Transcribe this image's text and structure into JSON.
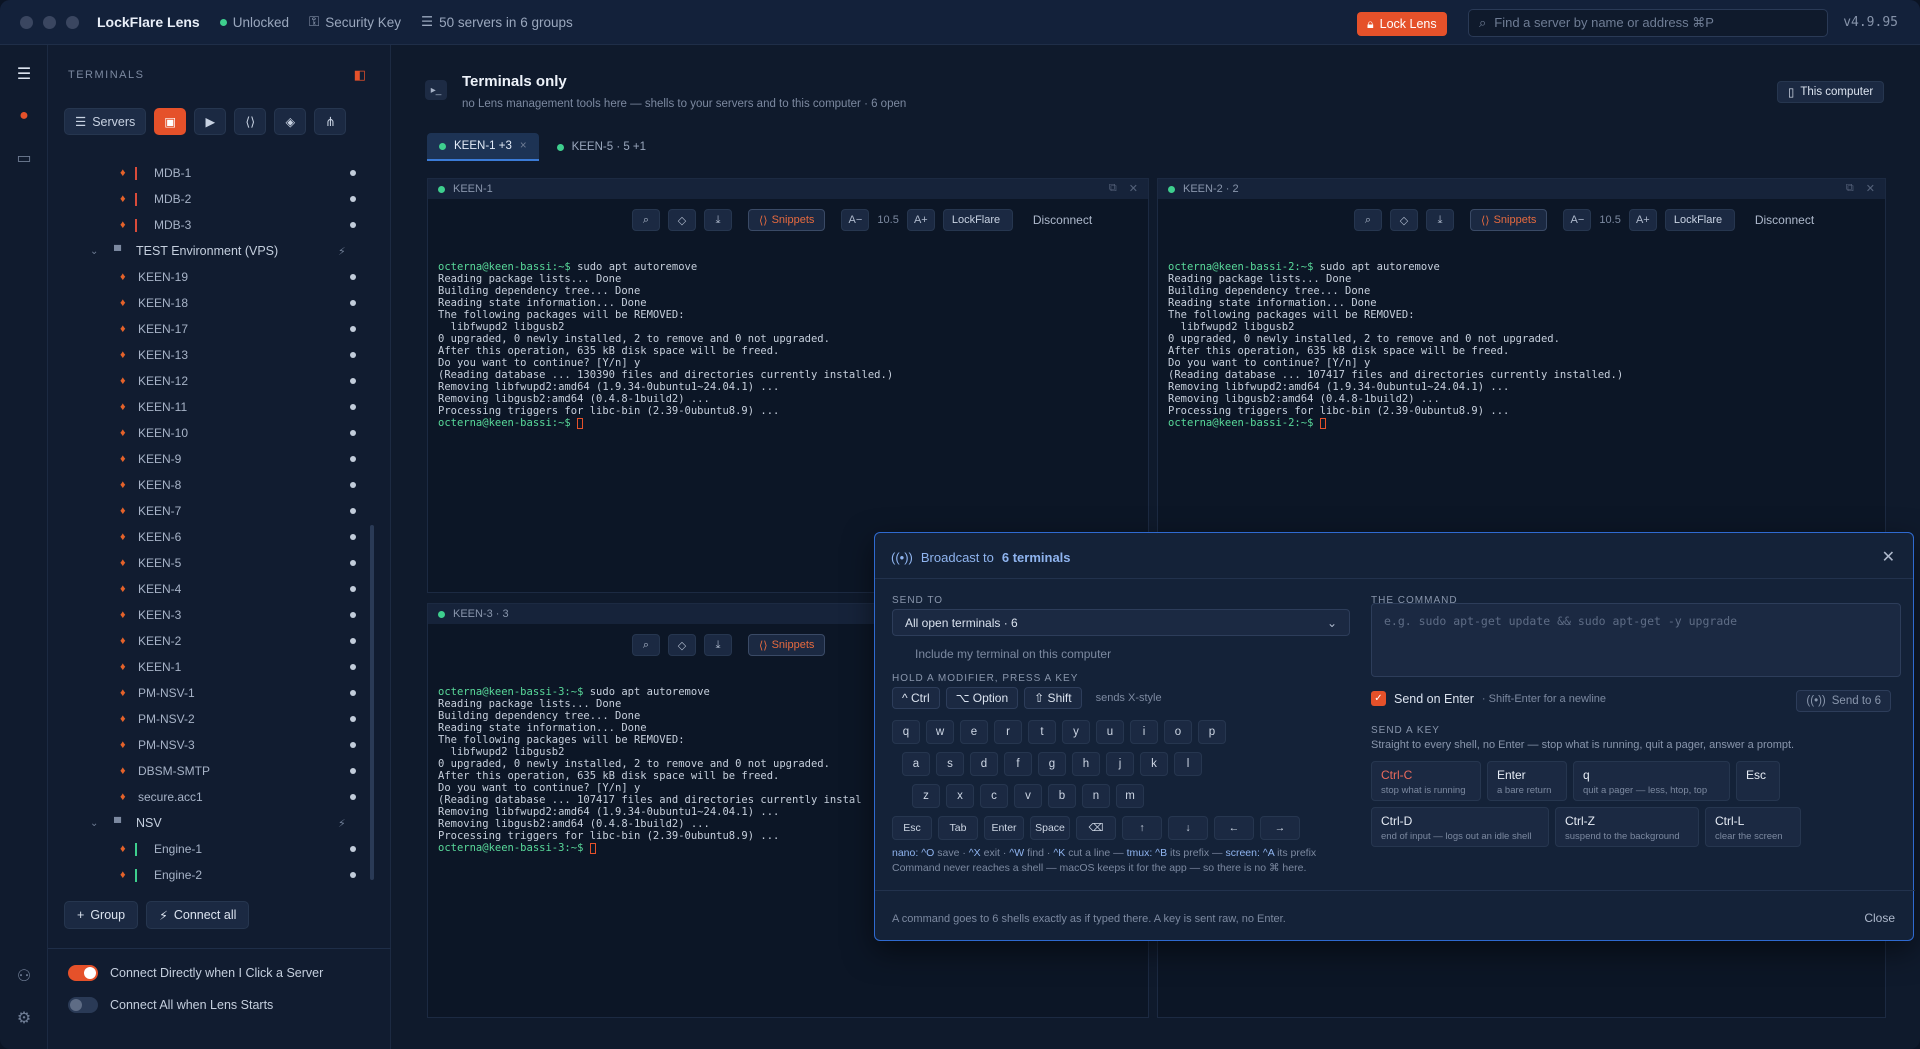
{
  "titlebar": {
    "app_name": "LockFlare Lens",
    "status": "Unlocked",
    "security_key": "Security Key",
    "servers_summary": "50 servers in 6 groups",
    "lock_button": "Lock Lens",
    "search_placeholder": "Find a server by name or address  ⌘P",
    "version": "v4.9.95"
  },
  "sidebar": {
    "title": "TERMINALS",
    "servers_button": "Servers",
    "tree": [
      {
        "type": "server",
        "label": "MDB-1",
        "bar": "red"
      },
      {
        "type": "server",
        "label": "MDB-2",
        "bar": "red"
      },
      {
        "type": "server",
        "label": "MDB-3",
        "bar": "red"
      },
      {
        "type": "group",
        "label": "TEST Environment (VPS)"
      },
      {
        "type": "server",
        "label": "KEEN-19"
      },
      {
        "type": "server",
        "label": "KEEN-18"
      },
      {
        "type": "server",
        "label": "KEEN-17"
      },
      {
        "type": "server",
        "label": "KEEN-13"
      },
      {
        "type": "server",
        "label": "KEEN-12"
      },
      {
        "type": "server",
        "label": "KEEN-11"
      },
      {
        "type": "server",
        "label": "KEEN-10"
      },
      {
        "type": "server",
        "label": "KEEN-9"
      },
      {
        "type": "server",
        "label": "KEEN-8"
      },
      {
        "type": "server",
        "label": "KEEN-7"
      },
      {
        "type": "server",
        "label": "KEEN-6"
      },
      {
        "type": "server",
        "label": "KEEN-5"
      },
      {
        "type": "server",
        "label": "KEEN-4"
      },
      {
        "type": "server",
        "label": "KEEN-3"
      },
      {
        "type": "server",
        "label": "KEEN-2"
      },
      {
        "type": "server",
        "label": "KEEN-1"
      },
      {
        "type": "server",
        "label": "PM-NSV-1"
      },
      {
        "type": "server",
        "label": "PM-NSV-2"
      },
      {
        "type": "server",
        "label": "PM-NSV-3"
      },
      {
        "type": "server",
        "label": "DBSM-SMTP"
      },
      {
        "type": "server",
        "label": "secure.acc1"
      },
      {
        "type": "group",
        "label": "NSV"
      },
      {
        "type": "server",
        "label": "Engine-1",
        "bar": "green"
      },
      {
        "type": "server",
        "label": "Engine-2",
        "bar": "green"
      }
    ],
    "group_button": "Group",
    "connect_all_button": "Connect all",
    "toggle_connect_directly": "Connect Directly when I Click a Server",
    "toggle_connect_all": "Connect All when Lens Starts"
  },
  "main": {
    "title": "Terminals only",
    "subtitle": "no Lens management tools here — shells to your servers and to this computer · 6 open",
    "this_computer": "This computer",
    "tabs": [
      {
        "label": "KEEN-1 +3"
      },
      {
        "label": "KEEN-5 · 5 +1"
      }
    ]
  },
  "pane_toolbar": {
    "snippets": "Snippets",
    "font_minus": "A−",
    "font_size": "10.5",
    "font_plus": "A+",
    "font_name": "LockFlare",
    "disconnect": "Disconnect"
  },
  "panes": [
    {
      "title": "KEEN-1",
      "prompt": "octerna@keen-bassi:~$",
      "lines": [
        "Reading package lists... Done",
        "Building dependency tree... Done",
        "Reading state information... Done",
        "The following packages will be REMOVED:",
        "  libfwupd2 libgusb2",
        "0 upgraded, 0 newly installed, 2 to remove and 0 not upgraded.",
        "After this operation, 635 kB disk space will be freed.",
        "Do you want to continue? [Y/n] y",
        "(Reading database ... 130390 files and directories currently installed.)",
        "Removing libfwupd2:amd64 (1.9.34-0ubuntu1~24.04.1) ...",
        "Removing libgusb2:amd64 (0.4.8-1build2) ...",
        "Processing triggers for libc-bin (2.39-0ubuntu8.9) ..."
      ]
    },
    {
      "title": "KEEN-2 · 2",
      "prompt": "octerna@keen-bassi-2:~$",
      "lines": [
        "Reading package lists... Done",
        "Building dependency tree... Done",
        "Reading state information... Done",
        "The following packages will be REMOVED:",
        "  libfwupd2 libgusb2",
        "0 upgraded, 0 newly installed, 2 to remove and 0 not upgraded.",
        "After this operation, 635 kB disk space will be freed.",
        "Do you want to continue? [Y/n] y",
        "(Reading database ... 107417 files and directories currently installed.)",
        "Removing libfwupd2:amd64 (1.9.34-0ubuntu1~24.04.1) ...",
        "Removing libgusb2:amd64 (0.4.8-1build2) ...",
        "Processing triggers for libc-bin (2.39-0ubuntu8.9) ..."
      ]
    },
    {
      "title": "KEEN-3 · 3",
      "prompt": "octerna@keen-bassi-3:~$",
      "lines": [
        "Reading package lists... Done",
        "Building dependency tree... Done",
        "Reading state information... Done",
        "The following packages will be REMOVED:",
        "  libfwupd2 libgusb2",
        "0 upgraded, 0 newly installed, 2 to remove and 0 not upgraded.",
        "After this operation, 635 kB disk space will be freed.",
        "Do you want to continue? [Y/n] y",
        "(Reading database ... 107417 files and directories currently instal",
        "Removing libfwupd2:amd64 (1.9.34-0ubuntu1~24.04.1) ...",
        "Removing libgusb2:amd64 (0.4.8-1build2) ...",
        "Processing triggers for libc-bin (2.39-0ubuntu8.9) ..."
      ]
    }
  ],
  "terminal_command": "sudo apt autoremove",
  "broadcast": {
    "title_prefix": "Broadcast to",
    "title_count": "6 terminals",
    "send_to_label": "SEND TO",
    "send_to_value": "All open terminals · 6",
    "include_local": "Include my terminal on this computer",
    "modifier_label": "HOLD A MODIFIER, PRESS A KEY",
    "modifiers": [
      "^ Ctrl",
      "⌥ Option",
      "⇧ Shift"
    ],
    "modifier_note": "sends X-style",
    "key_rows": [
      [
        "q",
        "w",
        "e",
        "r",
        "t",
        "y",
        "u",
        "i",
        "o",
        "p"
      ],
      [
        "a",
        "s",
        "d",
        "f",
        "g",
        "h",
        "j",
        "k",
        "l"
      ],
      [
        "z",
        "x",
        "c",
        "v",
        "b",
        "n",
        "m"
      ],
      [
        "Esc",
        "Tab",
        "Enter",
        "Space",
        "⌫",
        "↑",
        "↓",
        "←",
        "→"
      ]
    ],
    "hint_nano": "nano:",
    "hint_k1": "^O",
    "hint_t1": "save ·",
    "hint_k2": "^X",
    "hint_t2": "exit ·",
    "hint_k3": "^W",
    "hint_t3": "find ·",
    "hint_k4": "^K",
    "hint_t4": "cut a line —",
    "hint_tmux": "tmux:",
    "hint_k5": "^B",
    "hint_t5": "its prefix —",
    "hint_screen": "screen:",
    "hint_k6": "^A",
    "hint_t6": "its prefix",
    "hint_note": "Command never reaches a shell — macOS keeps it for the app — so there is no ⌘ here.",
    "command_label": "THE COMMAND",
    "command_placeholder": "e.g. sudo apt-get update && sudo apt-get -y upgrade",
    "send_on_enter": "Send on Enter",
    "send_on_enter_sub": "· Shift-Enter for a newline",
    "send_button": "Send to 6",
    "send_key_label": "SEND A KEY",
    "send_key_desc": "Straight to every shell, no Enter — stop what is running, quit a pager, answer a prompt.",
    "send_keys": [
      {
        "key": "Ctrl-C",
        "desc": "stop what is running"
      },
      {
        "key": "Enter",
        "desc": "a bare return"
      },
      {
        "key": "q",
        "desc": "quit a pager — less, htop, top"
      },
      {
        "key": "Esc",
        "desc": ""
      },
      {
        "key": "Ctrl-D",
        "desc": "end of input — logs out an idle shell"
      },
      {
        "key": "Ctrl-Z",
        "desc": "suspend to the background"
      },
      {
        "key": "Ctrl-L",
        "desc": "clear the screen"
      }
    ],
    "footer": "A command goes to 6 shells exactly as if typed there. A key is sent raw, no Enter.",
    "close": "Close"
  }
}
